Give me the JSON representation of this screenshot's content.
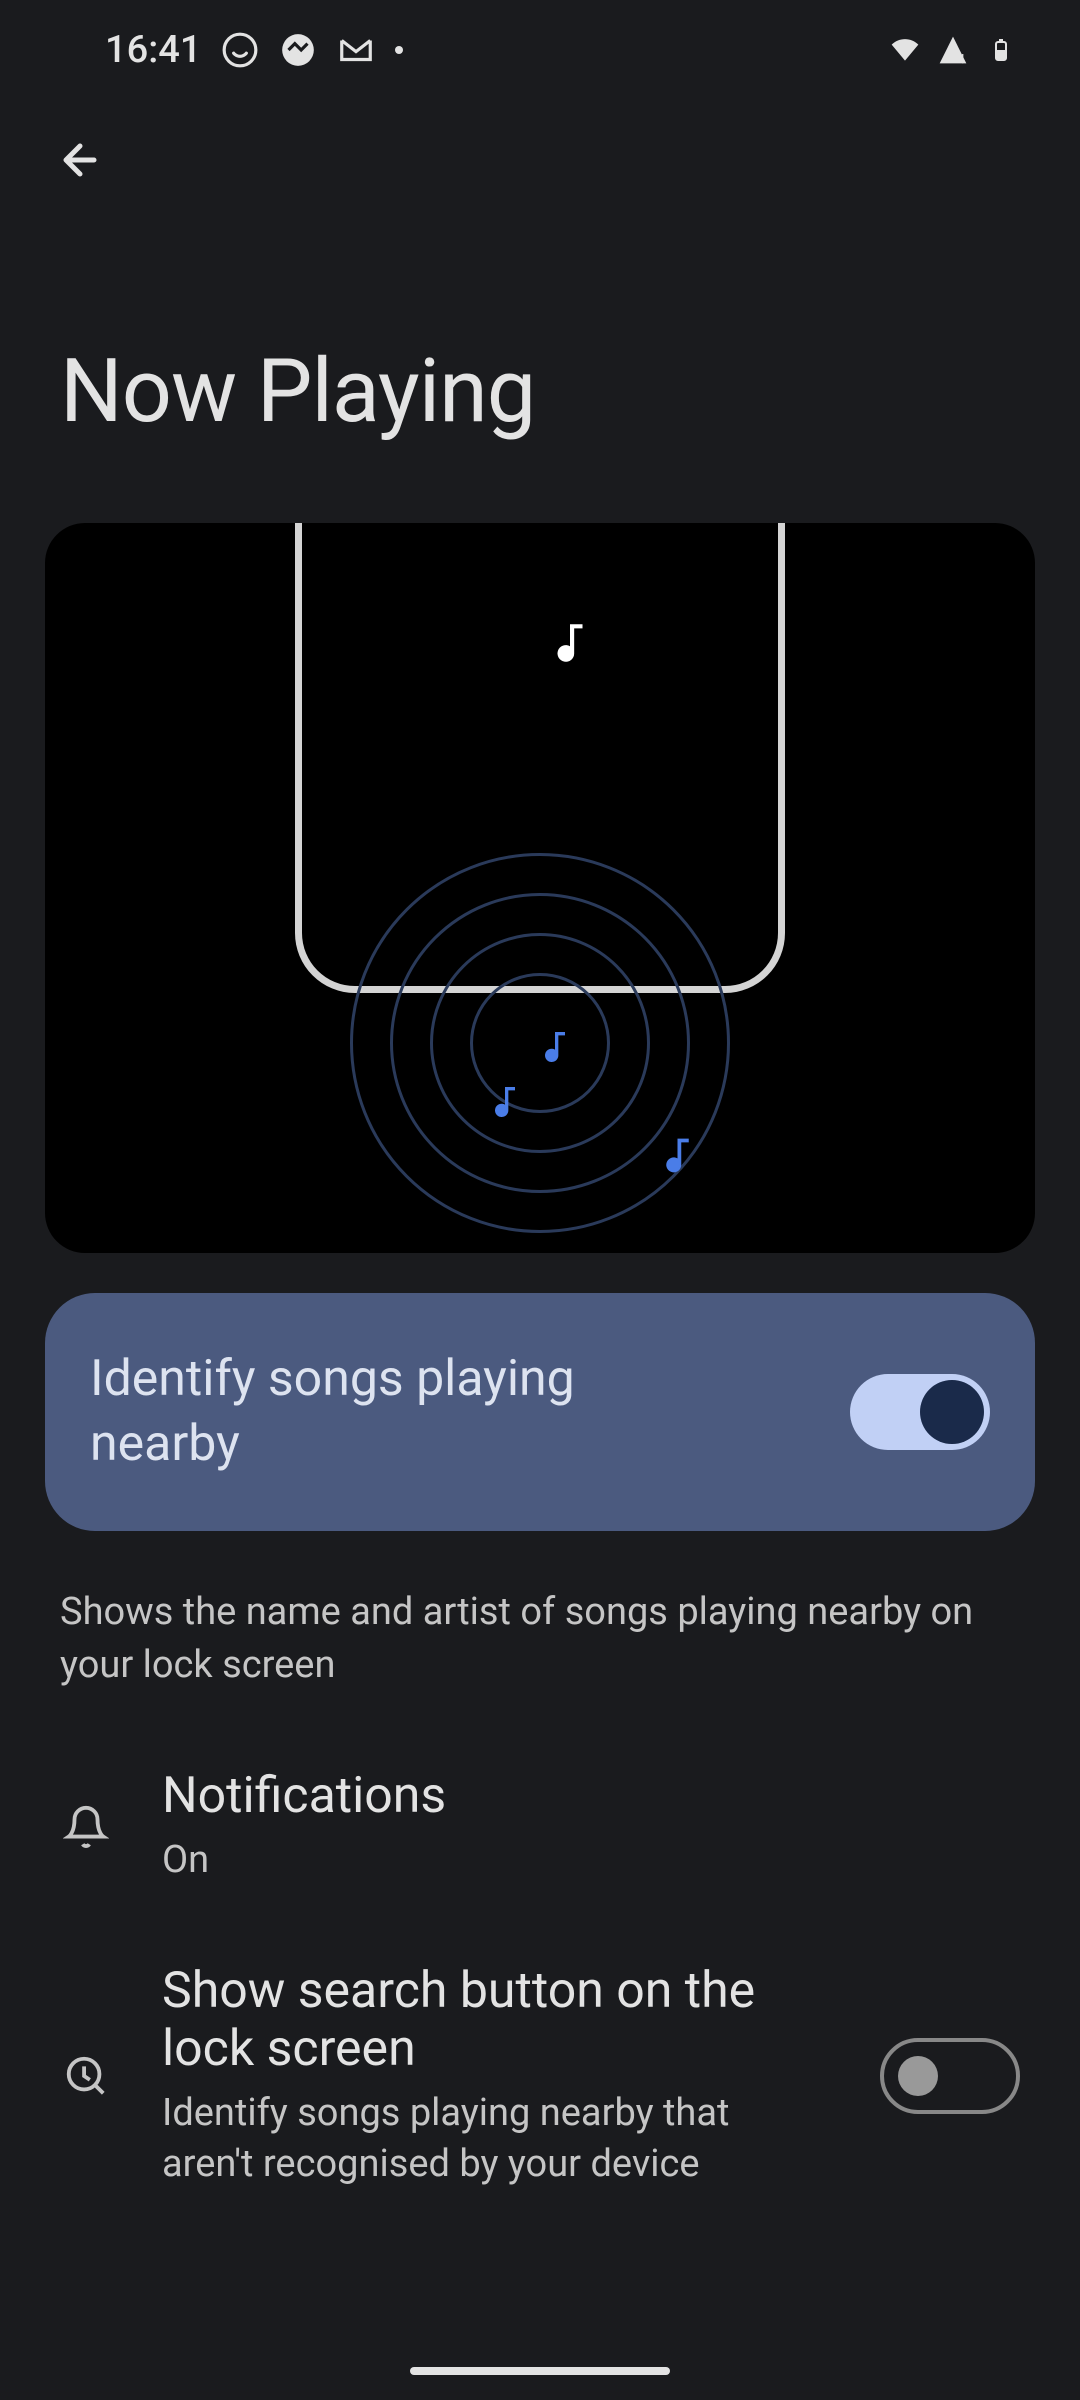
{
  "status": {
    "time": "16:41"
  },
  "page": {
    "title": "Now Playing"
  },
  "toggle": {
    "label": "Identify songs playing nearby",
    "enabled": true
  },
  "description": "Shows the name and artist of songs playing nearby on your lock screen",
  "settings": [
    {
      "title": "Notifications",
      "subtitle": "On"
    },
    {
      "title": "Show search button on the lock screen",
      "subtitle": "Identify songs playing nearby that aren't recognised by your device",
      "toggle": false
    }
  ]
}
